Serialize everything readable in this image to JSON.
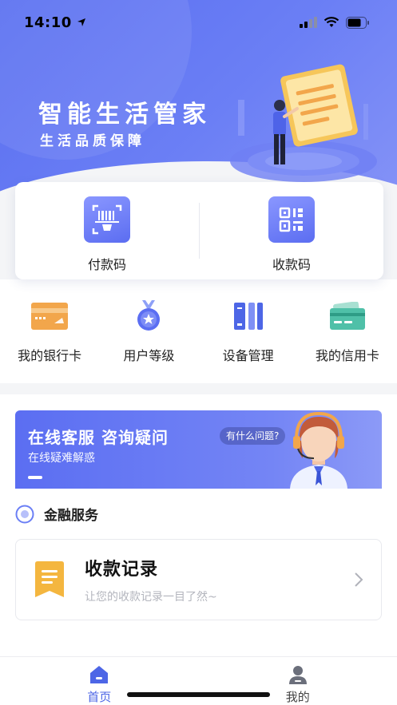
{
  "status_bar": {
    "time": "14:10"
  },
  "hero": {
    "title": "智能生活管家",
    "subtitle": "生活品质保障"
  },
  "pay_card": {
    "items": [
      {
        "label": "付款码",
        "icon": "barcode-scan-icon"
      },
      {
        "label": "收款码",
        "icon": "qr-code-icon"
      }
    ]
  },
  "quick_actions": [
    {
      "label": "我的银行卡",
      "icon": "bank-card-icon"
    },
    {
      "label": "用户等级",
      "icon": "medal-icon"
    },
    {
      "label": "设备管理",
      "icon": "device-icon"
    },
    {
      "label": "我的信用卡",
      "icon": "credit-card-icon"
    }
  ],
  "banner": {
    "title": "在线客服 咨询疑问",
    "subtitle": "在线疑难解惑",
    "bubble": "有什么问题?"
  },
  "finance_section": {
    "title": "金融服务"
  },
  "record_card": {
    "title": "收款记录",
    "description": "让您的收款记录一目了然~"
  },
  "tabbar": {
    "tabs": [
      {
        "label": "首页",
        "active": true
      },
      {
        "label": "我的",
        "active": false
      }
    ]
  },
  "colors": {
    "primary": "#5a6ff0",
    "active_tab": "#4d66e6",
    "orange": "#f2a64b",
    "teal": "#4fc0a8",
    "record_icon": "#f4b63f"
  }
}
